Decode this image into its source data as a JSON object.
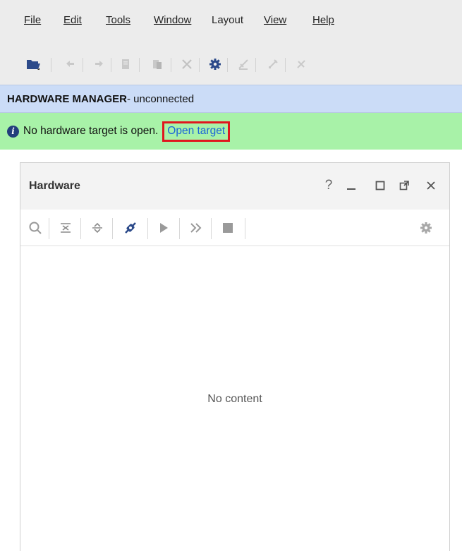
{
  "menubar": {
    "items": [
      {
        "label": "File",
        "mnemonic_index": 0
      },
      {
        "label": "Edit",
        "mnemonic_index": 0
      },
      {
        "label": "Tools",
        "mnemonic_index": 0
      },
      {
        "label": "Window",
        "mnemonic_index": 0
      },
      {
        "label": "Layout",
        "mnemonic_index": 2
      },
      {
        "label": "View",
        "mnemonic_index": 0
      },
      {
        "label": "Help",
        "mnemonic_index": 0
      }
    ]
  },
  "toolbar": {
    "icons": [
      "open-project-icon",
      "undo-icon",
      "redo-icon",
      "copy-icon",
      "paste-icon",
      "delete-icon",
      "settings-icon",
      "auto-connect-icon",
      "disabled-edit-icon",
      "disabled-remove-icon"
    ]
  },
  "hardware_manager": {
    "title": "HARDWARE MANAGER",
    "status": " - unconnected"
  },
  "banner": {
    "message": "No hardware target is open.",
    "link": "Open target",
    "highlight_color": "#e0161e"
  },
  "panel": {
    "title": "Hardware",
    "help": "?",
    "empty_message": "No content"
  },
  "colors": {
    "header_bg": "#cbdcf7",
    "banner_bg": "#a8f2a8",
    "link": "#1a64d8"
  }
}
